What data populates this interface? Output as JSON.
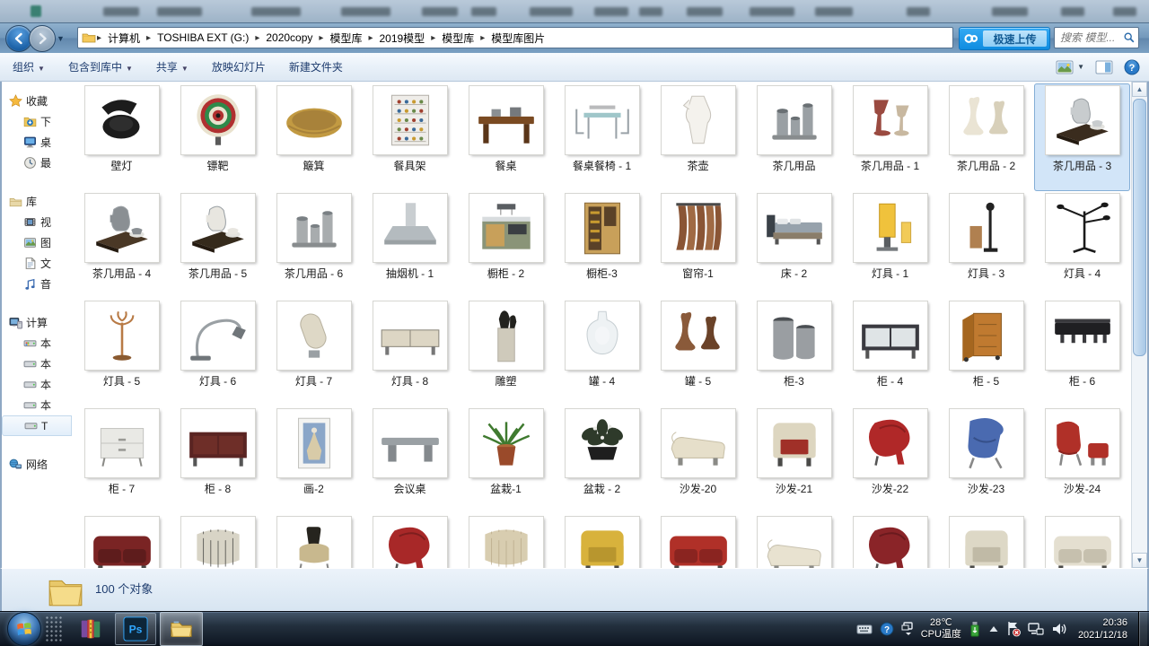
{
  "chrome": {
    "breadcrumbs": [
      "计算机",
      "TOSHIBA EXT (G:)",
      "2020copy",
      "模型库",
      "2019模型",
      "模型库",
      "模型库图片"
    ],
    "netdisk_label": "极速上传",
    "search_placeholder": "搜索 模型...",
    "toolbar": [
      {
        "label": "组织",
        "dropdown": true
      },
      {
        "label": "包含到库中",
        "dropdown": true
      },
      {
        "label": "共享",
        "dropdown": true
      },
      {
        "label": "放映幻灯片",
        "dropdown": false
      },
      {
        "label": "新建文件夹",
        "dropdown": false
      }
    ],
    "accent_blue": "#0f8ce0",
    "glass_blue": "#7399bc"
  },
  "sidebar": {
    "groups": [
      {
        "icon": "star",
        "label": "收藏",
        "items": [
          {
            "icon": "download",
            "label": "下"
          },
          {
            "icon": "desktop",
            "label": "桌"
          },
          {
            "icon": "recent",
            "label": "最"
          }
        ]
      },
      {
        "icon": "library",
        "label": "库",
        "items": [
          {
            "icon": "video",
            "label": "视"
          },
          {
            "icon": "picture",
            "label": "图"
          },
          {
            "icon": "doc",
            "label": "文"
          },
          {
            "icon": "music",
            "label": "音"
          }
        ]
      },
      {
        "icon": "computer",
        "label": "计算",
        "items": [
          {
            "icon": "sysdrive",
            "label": "本"
          },
          {
            "icon": "drive",
            "label": "本"
          },
          {
            "icon": "drive",
            "label": "本"
          },
          {
            "icon": "drive",
            "label": "本"
          },
          {
            "icon": "drive",
            "label": "T",
            "selected": true
          }
        ]
      },
      {
        "icon": "network",
        "label": "网络",
        "items": []
      }
    ]
  },
  "items": [
    {
      "label": "壁灯",
      "k": "walllamp",
      "c1": "#1c1c1c",
      "c2": "#2e2e2e"
    },
    {
      "label": "镖靶",
      "k": "target",
      "c1": "#b03030",
      "c2": "#2e8a4a"
    },
    {
      "label": "簸箕",
      "k": "bowl",
      "c1": "#c29a42",
      "c2": "#a8823a"
    },
    {
      "label": "餐具架",
      "k": "rack",
      "c1": "#efede9",
      "c2": "#b8b4ac"
    },
    {
      "label": "餐桌",
      "k": "table",
      "c1": "#7a4a22",
      "c2": "#5a3518"
    },
    {
      "label": "餐桌餐椅 - 1",
      "k": "tableset",
      "c1": "#9fc6c9",
      "c2": "#9aa2a8"
    },
    {
      "label": "茶壶",
      "k": "pitcher",
      "c1": "#f4f2ed",
      "c2": "#c8c4bc"
    },
    {
      "label": "茶几用品",
      "k": "cups",
      "c1": "#9aa0a4",
      "c2": "#6a7074"
    },
    {
      "label": "茶几用品 - 1",
      "k": "goblets",
      "c1": "#9a4a40",
      "c2": "#c8b8a0"
    },
    {
      "label": "茶几用品 - 2",
      "k": "vases",
      "c1": "#eae4d4",
      "c2": "#d8d0ba"
    },
    {
      "label": "茶几用品 - 3",
      "k": "traypot",
      "c1": "#3a2c1e",
      "c2": "#c8ccce",
      "selected": true
    },
    {
      "label": "茶几用品 - 4",
      "k": "traypot",
      "c1": "#4a3826",
      "c2": "#8a8f93"
    },
    {
      "label": "茶几用品 - 5",
      "k": "traypot",
      "c1": "#352a1c",
      "c2": "#e8e6e0"
    },
    {
      "label": "茶几用品 - 6",
      "k": "cups",
      "c1": "#a8acae",
      "c2": "#7a8084"
    },
    {
      "label": "抽烟机 - 1",
      "k": "hood",
      "c1": "#c9ced1",
      "c2": "#b4bbbf"
    },
    {
      "label": "橱柜 - 2",
      "k": "island",
      "c1": "#8a9478",
      "c2": "#c8a05a"
    },
    {
      "label": "橱柜-3",
      "k": "cabinet",
      "c1": "#c8a05a",
      "c2": "#5a4228"
    },
    {
      "label": "窗帘-1",
      "k": "curtain",
      "c1": "#8a5535",
      "c2": "#a06a44"
    },
    {
      "label": "床 - 2",
      "k": "bed",
      "c1": "#97a2ac",
      "c2": "#3a4148"
    },
    {
      "label": "灯具 - 1",
      "k": "lampbox",
      "c1": "#f0c23c",
      "c2": "#c89a20"
    },
    {
      "label": "灯具 - 3",
      "k": "lamppole",
      "c1": "#222222",
      "c2": "#b08050"
    },
    {
      "label": "灯具 - 4",
      "k": "lamparms",
      "c1": "#1a1a1a",
      "c2": "#333333"
    },
    {
      "label": "灯具 - 5",
      "k": "candelabra",
      "c1": "#b87a45",
      "c2": "#8a5a30"
    },
    {
      "label": "灯具 - 6",
      "k": "arclamp",
      "c1": "#9aa0a4",
      "c2": "#70767a"
    },
    {
      "label": "灯具 - 7",
      "k": "lamptilt",
      "c1": "#ded8c6",
      "c2": "#b8b2a0"
    },
    {
      "label": "灯具 - 8",
      "k": "lowboard",
      "c1": "#ddd6c4",
      "c2": "#8a857a"
    },
    {
      "label": "雕塑",
      "k": "sculpt",
      "c1": "#cfcabb",
      "c2": "#22221e"
    },
    {
      "label": "罐 - 4",
      "k": "vase",
      "c1": "#eef2f4",
      "c2": "#c8d0d4"
    },
    {
      "label": "罐 - 5",
      "k": "vases",
      "c1": "#8a5a3a",
      "c2": "#6a4228"
    },
    {
      "label": "柜-3",
      "k": "cyls",
      "c1": "#9a9ea2",
      "c2": "#4a4e52"
    },
    {
      "label": "柜 - 4",
      "k": "sideboard",
      "c1": "#3a3a40",
      "c2": "#dfe4e6"
    },
    {
      "label": "柜 - 5",
      "k": "opencab",
      "c1": "#c07a30",
      "c2": "#a5661f"
    },
    {
      "label": "柜 - 6",
      "k": "wallcab",
      "c1": "#1f1f22",
      "c2": "#3a3a3e"
    },
    {
      "label": "柜 - 7",
      "k": "dresser",
      "c1": "#e9e9e5",
      "c2": "#c4c4c0"
    },
    {
      "label": "柜 - 8",
      "k": "sideboard",
      "c1": "#5a2422",
      "c2": "#6e2e28"
    },
    {
      "label": "画-2",
      "k": "frame",
      "c1": "#f4f4f2",
      "c2": "#8aa6c8"
    },
    {
      "label": "会议桌",
      "k": "mtable",
      "c1": "#9aa0a4",
      "c2": "#84898d"
    },
    {
      "label": "盆栽-1",
      "k": "plant",
      "c1": "#3f7a2f",
      "c2": "#9a4a2a"
    },
    {
      "label": "盆栽 - 2",
      "k": "plant2",
      "c1": "#2e3a2a",
      "c2": "#1e1e1e"
    },
    {
      "label": "沙发-20",
      "k": "chaise",
      "c1": "#e6dfca",
      "c2": "#c8c0a8"
    },
    {
      "label": "沙发-21",
      "k": "armchair",
      "c1": "#ddd6c0",
      "c2": "#a03028"
    },
    {
      "label": "沙发-22",
      "k": "cocoon",
      "c1": "#b02828",
      "c2": "#8a1e1e"
    },
    {
      "label": "沙发-23",
      "k": "chair",
      "c1": "#4a6ab0",
      "c2": "#36508a"
    },
    {
      "label": "沙发-24",
      "k": "chairott",
      "c1": "#b03028",
      "c2": "#8a2420"
    },
    {
      "label": "",
      "k": "sofa",
      "c1": "#7a2424",
      "c2": "#5e1c1c"
    },
    {
      "label": "",
      "k": "barrel",
      "c1": "#d8d4c6",
      "c2": "#3a3a38"
    },
    {
      "label": "",
      "k": "stool",
      "c1": "#c8b88e",
      "c2": "#26241e"
    },
    {
      "label": "",
      "k": "cocoon",
      "c1": "#a82828",
      "c2": "#7e1e1e"
    },
    {
      "label": "",
      "k": "barrel",
      "c1": "#d8cdb0",
      "c2": "#b8a888"
    },
    {
      "label": "",
      "k": "armchair",
      "c1": "#d8b23c",
      "c2": "#b8962e"
    },
    {
      "label": "",
      "k": "sofa",
      "c1": "#b03028",
      "c2": "#8a2420"
    },
    {
      "label": "",
      "k": "chaise",
      "c1": "#e8e2d0",
      "c2": "#c8c2b0"
    },
    {
      "label": "",
      "k": "cocoon",
      "c1": "#8a2428",
      "c2": "#6a1a1e"
    },
    {
      "label": "",
      "k": "armchair",
      "c1": "#ddd8c6",
      "c2": "#c0baa6"
    },
    {
      "label": "",
      "k": "sofa",
      "c1": "#e4dfd0",
      "c2": "#c6c0ae"
    }
  ],
  "status": {
    "text": "100 个对象"
  },
  "taskbar": {
    "temp": "28℃",
    "temp_label": "CPU温度",
    "time": "20:36",
    "date": "2021/12/18"
  }
}
